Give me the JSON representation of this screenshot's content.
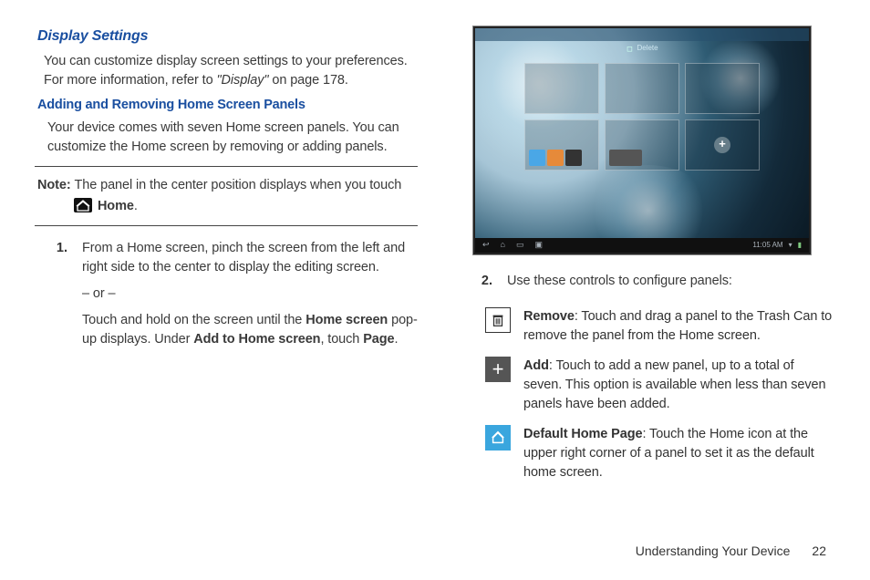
{
  "left": {
    "section_title": "Display Settings",
    "intro": "You can customize display screen settings to your preferences. For more information, refer to ",
    "intro_ref": "\"Display\"",
    "intro_tail": " on page 178.",
    "sub_title": "Adding and Removing Home Screen Panels",
    "para2": "Your device comes with seven Home screen panels. You can customize the Home screen by removing or adding panels.",
    "note_l1_prefix": "Note: ",
    "note_l1_rest": "The panel in the center position displays when you touch",
    "note_l2_home": "Home",
    "note_l2_tail": ".",
    "step1_num": "1.",
    "step1_p1": "From a Home screen, pinch the screen from the left and right side to the center to display the editing screen.",
    "step1_or": "– or –",
    "step1_p2a": "Touch and hold on the screen until the ",
    "step1_p2b": "Home screen",
    "step1_p2c": " pop-up displays. Under ",
    "step1_p2d": "Add to Home screen",
    "step1_p2e": ", touch ",
    "step1_p2f": "Page",
    "step1_p2g": "."
  },
  "right": {
    "screenshot": {
      "trash_label": "Delete",
      "clock": "11:05 AM"
    },
    "step2_num": "2.",
    "step2_text": "Use these controls to configure panels:",
    "controls": [
      {
        "label": "Remove",
        "text": ": Touch and drag a panel to the Trash Can to remove the panel from the Home screen."
      },
      {
        "label": "Add",
        "text": ": Touch to add a new panel, up to a total of seven. This option is available when less than seven panels have been added."
      },
      {
        "label": "Default Home Page",
        "text": ": Touch the Home icon at the upper right corner of a panel to set it as the default home screen."
      }
    ]
  },
  "footer": {
    "section": "Understanding Your Device",
    "page": "22"
  }
}
